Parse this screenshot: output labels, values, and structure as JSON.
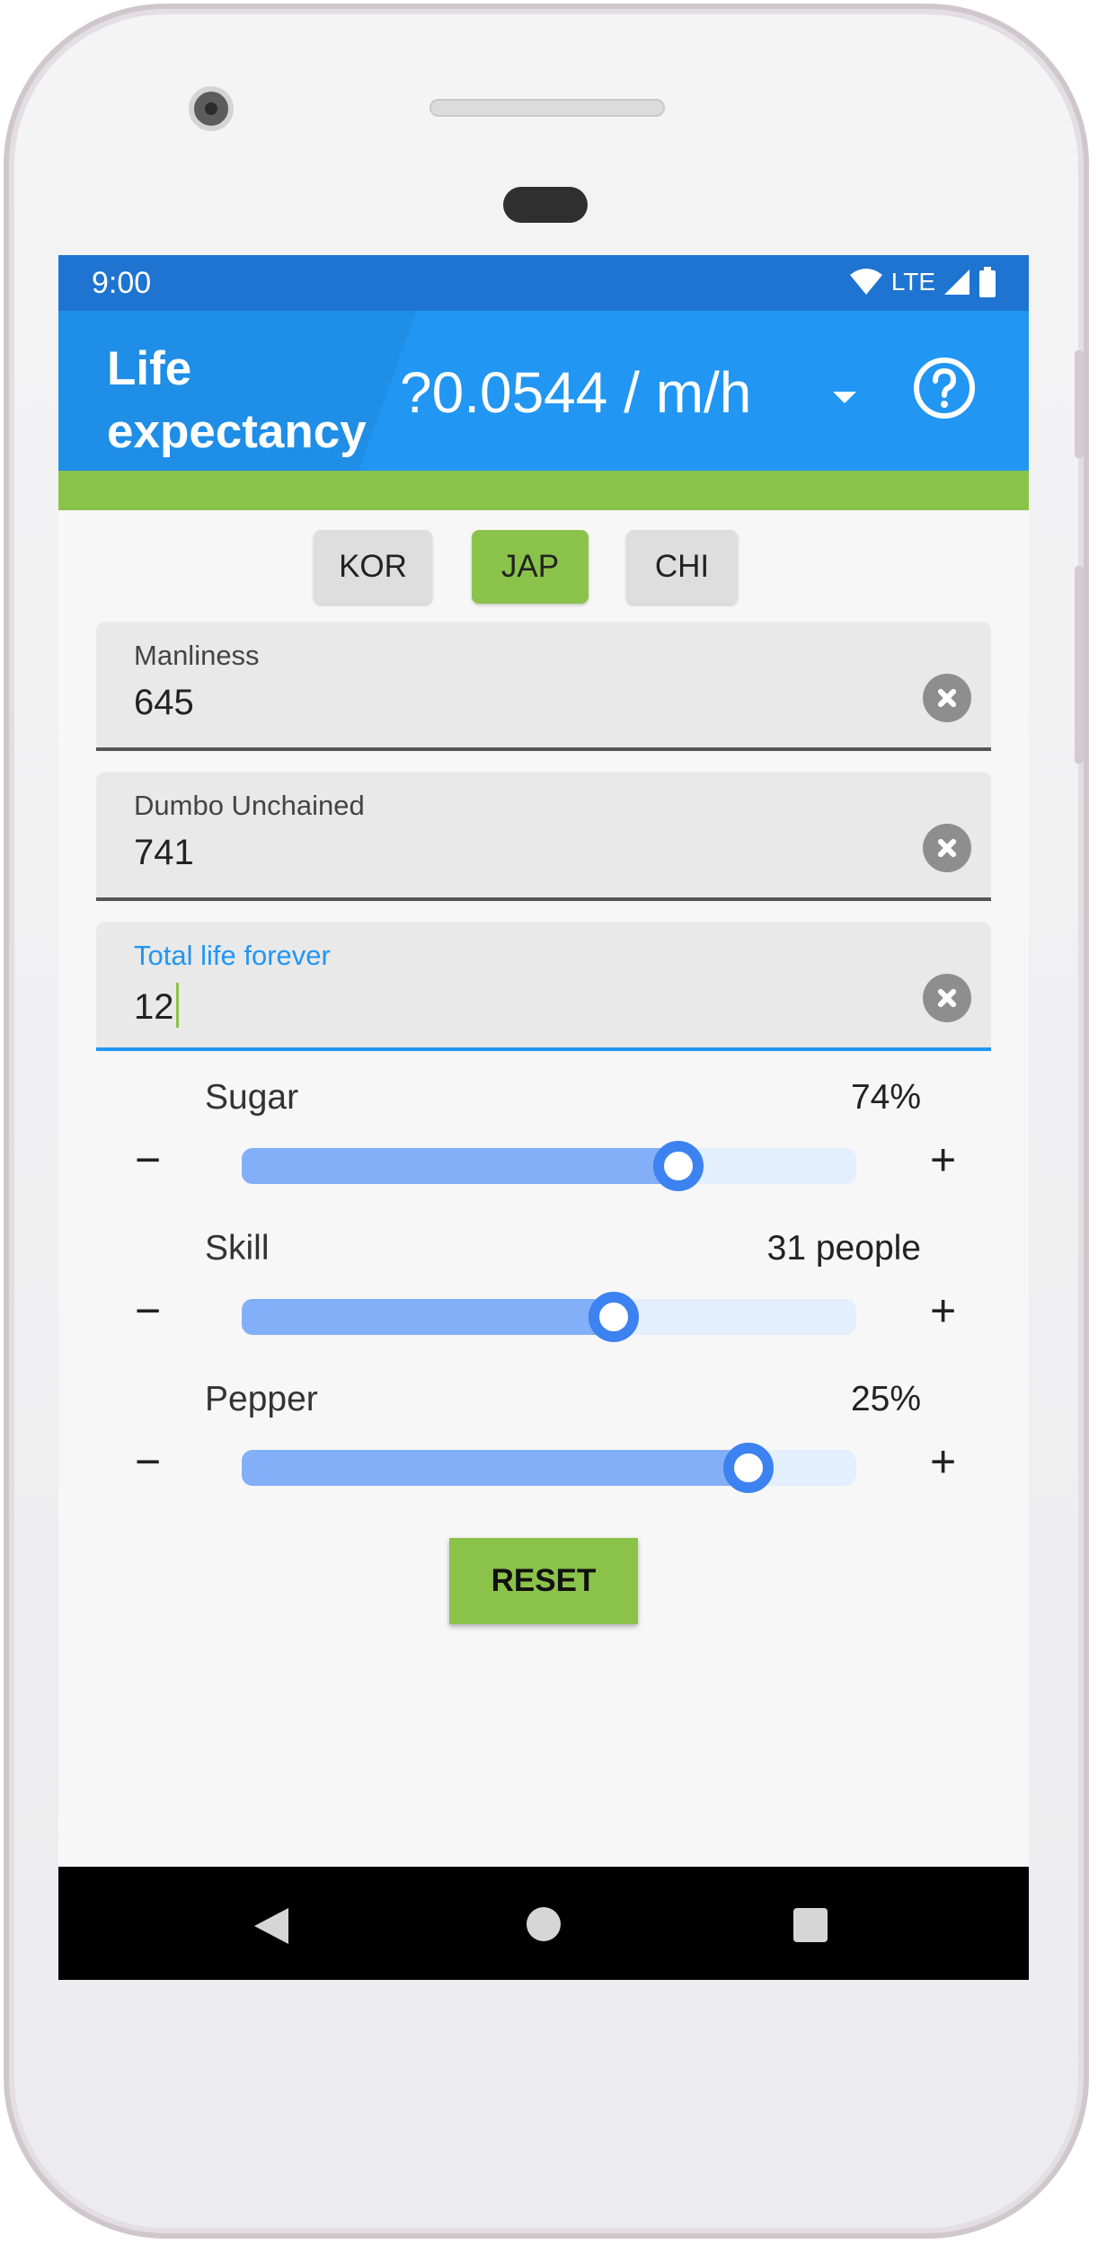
{
  "status_bar": {
    "time": "9:00",
    "network": "LTE",
    "icons": [
      "wifi-icon",
      "cell-signal-icon",
      "battery-icon"
    ]
  },
  "app_bar": {
    "title_line1": "Life",
    "title_line2": "expectancy",
    "rate": "?0.0544 / m/h",
    "dropdown_icon": "dropdown-arrow-icon",
    "help_icon": "help-circle-icon"
  },
  "chips": [
    {
      "label": "KOR",
      "selected": false
    },
    {
      "label": "JAP",
      "selected": true
    },
    {
      "label": "CHI",
      "selected": false
    }
  ],
  "fields": [
    {
      "label": "Manliness",
      "value": "645",
      "focused": false
    },
    {
      "label": "Dumbo Unchained",
      "value": "741",
      "focused": false
    },
    {
      "label": "Total life forever",
      "value": "12",
      "focused": true
    }
  ],
  "sliders": [
    {
      "label": "Sugar",
      "value_text": "74%",
      "position": 0.71,
      "minus": "−",
      "plus": "+"
    },
    {
      "label": "Skill",
      "value_text": "31 people",
      "position": 0.605,
      "minus": "−",
      "plus": "+"
    },
    {
      "label": "Pepper",
      "value_text": "25%",
      "position": 0.825,
      "minus": "−",
      "plus": "+"
    }
  ],
  "reset_label": "RESET",
  "colors": {
    "status_bar": "#1e74d0",
    "app_bar": "#2196f3",
    "accent_green": "#8bc34a",
    "slider_fill": "#82aff7",
    "slider_track": "#e3effc",
    "slider_thumb": "#3c82f0"
  },
  "nav_bar": {
    "icons": [
      "back-icon",
      "home-icon",
      "recents-icon"
    ]
  }
}
